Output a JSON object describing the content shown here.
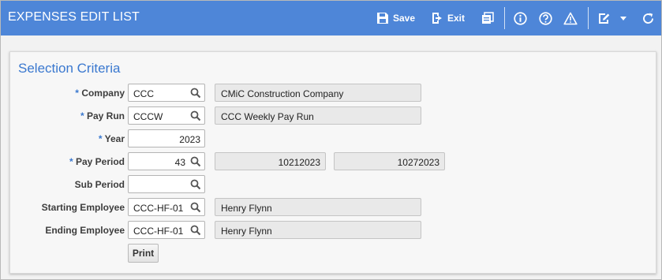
{
  "app": {
    "title": "EXPENSES EDIT LIST"
  },
  "toolbar": {
    "save_label": "Save",
    "exit_label": "Exit",
    "icons": [
      "save-icon",
      "exit-icon",
      "report-icon",
      "info-icon",
      "help-icon",
      "warning-icon",
      "edit-icon",
      "dropdown-arrow-icon",
      "refresh-icon"
    ]
  },
  "section": {
    "title": "Selection Criteria"
  },
  "form": {
    "required_marker": "*",
    "company": {
      "label": "Company",
      "value": "CCC",
      "description": "CMiC Construction Company",
      "required": true
    },
    "pay_run": {
      "label": "Pay Run",
      "value": "CCCW",
      "description": "CCC Weekly Pay Run",
      "required": true
    },
    "year": {
      "label": "Year",
      "value": "2023",
      "required": true
    },
    "pay_period": {
      "label": "Pay Period",
      "value": "43",
      "start_date": "10212023",
      "end_date": "10272023",
      "required": true
    },
    "sub_period": {
      "label": "Sub Period",
      "value": "",
      "required": false
    },
    "starting_employee": {
      "label": "Starting Employee",
      "value": "CCC-HF-01",
      "description": "Henry Flynn",
      "required": false
    },
    "ending_employee": {
      "label": "Ending Employee",
      "value": "CCC-HF-01",
      "description": "Henry Flynn",
      "required": false
    }
  },
  "actions": {
    "print_label": "Print"
  },
  "colors": {
    "header": "#4e86d8",
    "accent": "#3a78cf"
  }
}
